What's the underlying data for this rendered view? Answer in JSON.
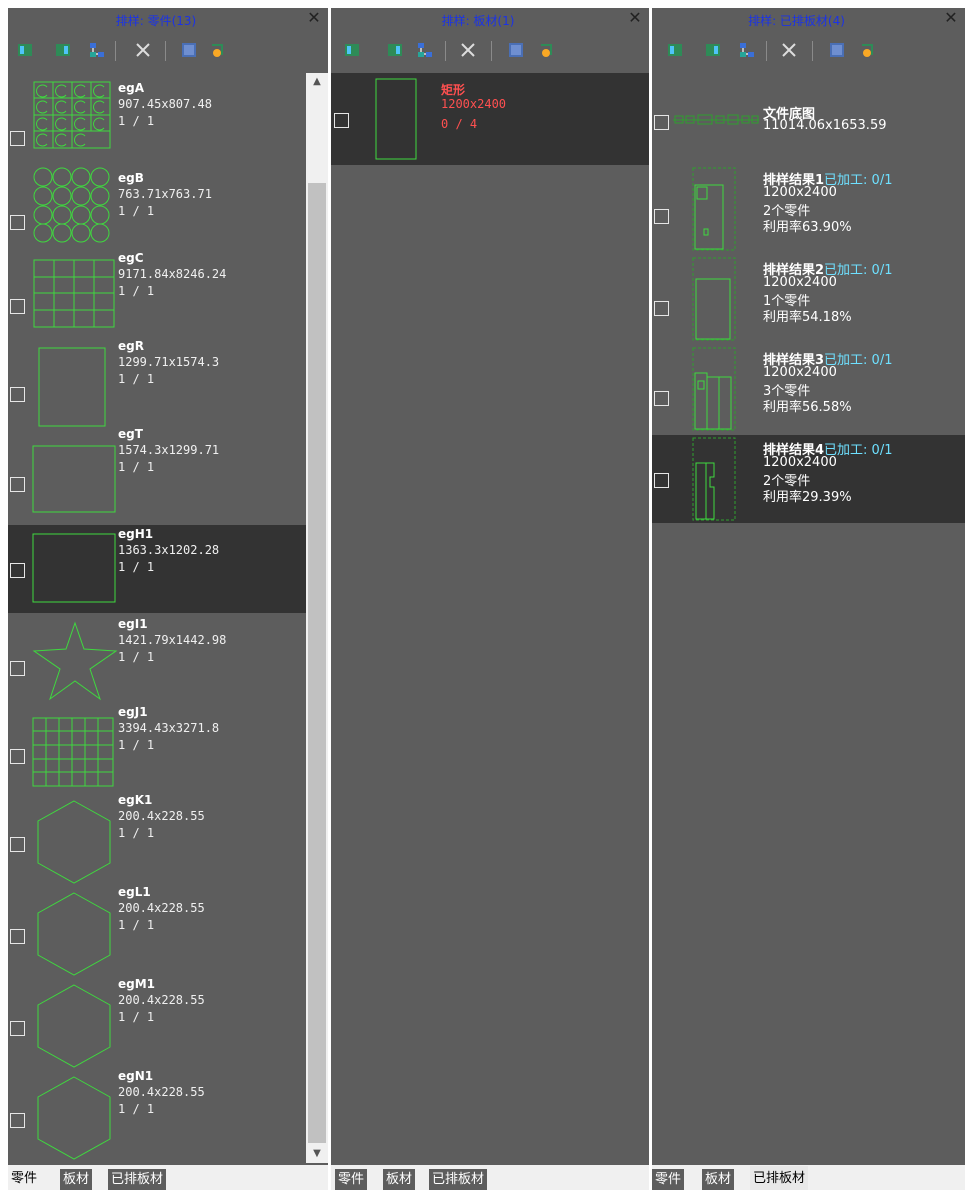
{
  "panels": {
    "parts": {
      "title": "排样: 零件(13)",
      "items": [
        {
          "name": "egA",
          "dim": "907.45x807.48",
          "count": "1 / 1"
        },
        {
          "name": "egB",
          "dim": "763.71x763.71",
          "count": "1 / 1"
        },
        {
          "name": "egC",
          "dim": "9171.84x8246.24",
          "count": "1 / 1"
        },
        {
          "name": "egR",
          "dim": "1299.71x1574.3",
          "count": "1 / 1"
        },
        {
          "name": "egT",
          "dim": "1574.3x1299.71",
          "count": "1 / 1"
        },
        {
          "name": "egH1",
          "dim": "1363.3x1202.28",
          "count": "1 / 1"
        },
        {
          "name": "egI1",
          "dim": "1421.79x1442.98",
          "count": "1 / 1"
        },
        {
          "name": "egJ1",
          "dim": "3394.43x3271.8",
          "count": "1 / 1"
        },
        {
          "name": "egK1",
          "dim": "200.4x228.55",
          "count": "1 / 1"
        },
        {
          "name": "egL1",
          "dim": "200.4x228.55",
          "count": "1 / 1"
        },
        {
          "name": "egM1",
          "dim": "200.4x228.55",
          "count": "1 / 1"
        },
        {
          "name": "egN1",
          "dim": "200.4x228.55",
          "count": "1 / 1"
        }
      ]
    },
    "sheets": {
      "title": "排样: 板材(1)",
      "items": [
        {
          "name": "矩形",
          "dim": "1200x2400",
          "count": "0 / 4"
        }
      ]
    },
    "nested": {
      "title": "排样: 已排板材(4)",
      "base": {
        "name": "文件底图",
        "dim": "11014.06x1653.59"
      },
      "results": [
        {
          "name": "排样结果1",
          "status": "已加工: 0/1",
          "size": "1200x2400",
          "parts": "2个零件",
          "util": "利用率63.90%"
        },
        {
          "name": "排样结果2",
          "status": "已加工: 0/1",
          "size": "1200x2400",
          "parts": "1个零件",
          "util": "利用率54.18%"
        },
        {
          "name": "排样结果3",
          "status": "已加工: 0/1",
          "size": "1200x2400",
          "parts": "3个零件",
          "util": "利用率56.58%"
        },
        {
          "name": "排样结果4",
          "status": "已加工: 0/1",
          "size": "1200x2400",
          "parts": "2个零件",
          "util": "利用率29.39%"
        }
      ]
    }
  },
  "tabs": {
    "parts": "零件",
    "sheets": "板材",
    "nested": "已排板材"
  },
  "colors": {
    "panel_bg": "#5d5d5d",
    "selected_bg": "#333333",
    "title": "#1b33e6",
    "outline": "#3fd93f",
    "alert": "#ff5050",
    "status": "#6ee0ff"
  },
  "icons": [
    "layout-icon",
    "layout-alt-icon",
    "tree-icon",
    "delete-icon",
    "select-icon",
    "export-icon"
  ]
}
